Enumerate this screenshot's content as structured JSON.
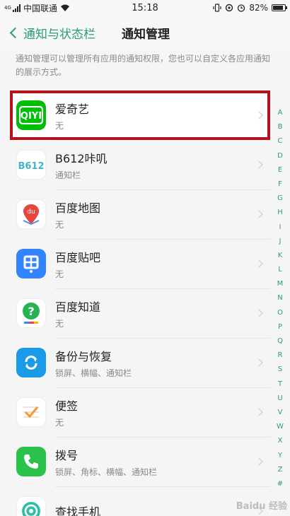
{
  "status_bar": {
    "network_tag": "4G",
    "carrier": "中国联通",
    "time": "15:18",
    "battery": "82%",
    "icons": [
      "signal-icon",
      "wifi-icon",
      "vibrate-icon",
      "sync-icon",
      "alarm-icon",
      "battery-icon"
    ]
  },
  "header": {
    "back_label": "通知与状态栏",
    "title": "通知管理"
  },
  "description": "通知管理可以管理所有应用的通知权限，您也可以自定义各应用通知的展示方式。",
  "apps": [
    {
      "name": "爱奇艺",
      "sub": "无",
      "icon": "iqiyi-icon",
      "color": "#00be06"
    },
    {
      "name": "B612咔叽",
      "sub": "通知栏",
      "icon": "b612-icon",
      "color": "#ffffff"
    },
    {
      "name": "百度地图",
      "sub": "无",
      "icon": "baidu-map-icon",
      "color": "#ffffff"
    },
    {
      "name": "百度贴吧",
      "sub": "无",
      "icon": "tieba-icon",
      "color": "#3385ff"
    },
    {
      "name": "百度知道",
      "sub": "无",
      "icon": "zhidao-icon",
      "color": "#ffffff"
    },
    {
      "name": "备份与恢复",
      "sub": "锁屏、横幅、通知栏",
      "icon": "backup-icon",
      "color": "#1a9be8"
    },
    {
      "name": "便签",
      "sub": "无",
      "icon": "notes-icon",
      "color": "#ffffff"
    },
    {
      "name": "拨号",
      "sub": "锁屏、角标、横幅、通知栏",
      "icon": "phone-icon",
      "color": "#2bc24b"
    },
    {
      "name": "查找手机",
      "sub": "",
      "icon": "find-phone-icon",
      "color": "#ffffff"
    }
  ],
  "alphabet": [
    "A",
    "B",
    "C",
    "D",
    "E",
    "F",
    "G",
    "H",
    "I",
    "J",
    "K",
    "L",
    "M",
    "N",
    "O",
    "P",
    "Q",
    "R",
    "S",
    "T",
    "U",
    "V",
    "W",
    "X",
    "Y",
    "Z",
    "#"
  ],
  "watermark": "Baidu 经验"
}
